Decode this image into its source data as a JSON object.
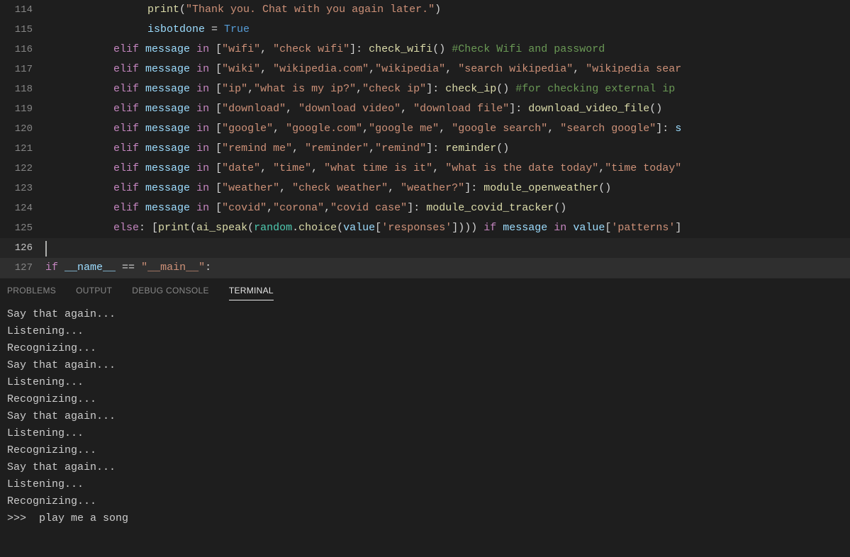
{
  "lines": {
    "start": 114,
    "rows": [
      {
        "n": 114,
        "indent": "i2",
        "tokens": [
          [
            "f",
            "print"
          ],
          [
            "p",
            "("
          ],
          [
            "s",
            "\"Thank you. Chat with you again later.\""
          ],
          [
            "p",
            ")"
          ]
        ]
      },
      {
        "n": 115,
        "indent": "i2",
        "tokens": [
          [
            "v",
            "isbotdone"
          ],
          [
            "o",
            " = "
          ],
          [
            "b",
            "True"
          ]
        ]
      },
      {
        "n": 116,
        "indent": "i1",
        "tokens": [
          [
            "k",
            "elif"
          ],
          [
            "o",
            " "
          ],
          [
            "v",
            "message"
          ],
          [
            "o",
            " "
          ],
          [
            "k",
            "in"
          ],
          [
            "o",
            " ["
          ],
          [
            "s",
            "\"wifi\""
          ],
          [
            "p",
            ", "
          ],
          [
            "s",
            "\"check wifi\""
          ],
          [
            "p",
            "]: "
          ],
          [
            "f",
            "check_wifi"
          ],
          [
            "p",
            "() "
          ],
          [
            "c",
            "#Check Wifi and password"
          ]
        ]
      },
      {
        "n": 117,
        "indent": "i1",
        "tokens": [
          [
            "k",
            "elif"
          ],
          [
            "o",
            " "
          ],
          [
            "v",
            "message"
          ],
          [
            "o",
            " "
          ],
          [
            "k",
            "in"
          ],
          [
            "o",
            " ["
          ],
          [
            "s",
            "\"wiki\""
          ],
          [
            "p",
            ", "
          ],
          [
            "s",
            "\"wikipedia.com\""
          ],
          [
            "p",
            ","
          ],
          [
            "s",
            "\"wikipedia\""
          ],
          [
            "p",
            ", "
          ],
          [
            "s",
            "\"search wikipedia\""
          ],
          [
            "p",
            ", "
          ],
          [
            "s",
            "\"wikipedia sear"
          ]
        ]
      },
      {
        "n": 118,
        "indent": "i1",
        "tokens": [
          [
            "k",
            "elif"
          ],
          [
            "o",
            " "
          ],
          [
            "v",
            "message"
          ],
          [
            "o",
            " "
          ],
          [
            "k",
            "in"
          ],
          [
            "o",
            " ["
          ],
          [
            "s",
            "\"ip\""
          ],
          [
            "p",
            ","
          ],
          [
            "s",
            "\"what is my ip?\""
          ],
          [
            "p",
            ","
          ],
          [
            "s",
            "\"check ip\""
          ],
          [
            "p",
            "]: "
          ],
          [
            "f",
            "check_ip"
          ],
          [
            "p",
            "() "
          ],
          [
            "c",
            "#for checking external ip "
          ]
        ]
      },
      {
        "n": 119,
        "indent": "i1",
        "tokens": [
          [
            "k",
            "elif"
          ],
          [
            "o",
            " "
          ],
          [
            "v",
            "message"
          ],
          [
            "o",
            " "
          ],
          [
            "k",
            "in"
          ],
          [
            "o",
            " ["
          ],
          [
            "s",
            "\"download\""
          ],
          [
            "p",
            ", "
          ],
          [
            "s",
            "\"download video\""
          ],
          [
            "p",
            ", "
          ],
          [
            "s",
            "\"download file\""
          ],
          [
            "p",
            "]: "
          ],
          [
            "f",
            "download_video_file"
          ],
          [
            "p",
            "()"
          ]
        ]
      },
      {
        "n": 120,
        "indent": "i1",
        "tokens": [
          [
            "k",
            "elif"
          ],
          [
            "o",
            " "
          ],
          [
            "v",
            "message"
          ],
          [
            "o",
            " "
          ],
          [
            "k",
            "in"
          ],
          [
            "o",
            " ["
          ],
          [
            "s",
            "\"google\""
          ],
          [
            "p",
            ", "
          ],
          [
            "s",
            "\"google.com\""
          ],
          [
            "p",
            ","
          ],
          [
            "s",
            "\"google me\""
          ],
          [
            "p",
            ", "
          ],
          [
            "s",
            "\"google search\""
          ],
          [
            "p",
            ", "
          ],
          [
            "s",
            "\"search google\""
          ],
          [
            "p",
            "]: "
          ],
          [
            "v",
            "s"
          ]
        ]
      },
      {
        "n": 121,
        "indent": "i1",
        "tokens": [
          [
            "k",
            "elif"
          ],
          [
            "o",
            " "
          ],
          [
            "v",
            "message"
          ],
          [
            "o",
            " "
          ],
          [
            "k",
            "in"
          ],
          [
            "o",
            " ["
          ],
          [
            "s",
            "\"remind me\""
          ],
          [
            "p",
            ", "
          ],
          [
            "s",
            "\"reminder\""
          ],
          [
            "p",
            ","
          ],
          [
            "s",
            "\"remind\""
          ],
          [
            "p",
            "]: "
          ],
          [
            "f",
            "reminder"
          ],
          [
            "p",
            "()"
          ]
        ]
      },
      {
        "n": 122,
        "indent": "i1",
        "tokens": [
          [
            "k",
            "elif"
          ],
          [
            "o",
            " "
          ],
          [
            "v",
            "message"
          ],
          [
            "o",
            " "
          ],
          [
            "k",
            "in"
          ],
          [
            "o",
            " ["
          ],
          [
            "s",
            "\"date\""
          ],
          [
            "p",
            ", "
          ],
          [
            "s",
            "\"time\""
          ],
          [
            "p",
            ", "
          ],
          [
            "s",
            "\"what time is it\""
          ],
          [
            "p",
            ", "
          ],
          [
            "s",
            "\"what is the date today\""
          ],
          [
            "p",
            ","
          ],
          [
            "s",
            "\"time today\""
          ]
        ]
      },
      {
        "n": 123,
        "indent": "i1",
        "tokens": [
          [
            "k",
            "elif"
          ],
          [
            "o",
            " "
          ],
          [
            "v",
            "message"
          ],
          [
            "o",
            " "
          ],
          [
            "k",
            "in"
          ],
          [
            "o",
            " ["
          ],
          [
            "s",
            "\"weather\""
          ],
          [
            "p",
            ", "
          ],
          [
            "s",
            "\"check weather\""
          ],
          [
            "p",
            ", "
          ],
          [
            "s",
            "\"weather?\""
          ],
          [
            "p",
            "]: "
          ],
          [
            "f",
            "module_openweather"
          ],
          [
            "p",
            "()"
          ]
        ]
      },
      {
        "n": 124,
        "indent": "i1",
        "tokens": [
          [
            "k",
            "elif"
          ],
          [
            "o",
            " "
          ],
          [
            "v",
            "message"
          ],
          [
            "o",
            " "
          ],
          [
            "k",
            "in"
          ],
          [
            "o",
            " ["
          ],
          [
            "s",
            "\"covid\""
          ],
          [
            "p",
            ","
          ],
          [
            "s",
            "\"corona\""
          ],
          [
            "p",
            ","
          ],
          [
            "s",
            "\"covid case\""
          ],
          [
            "p",
            "]: "
          ],
          [
            "f",
            "module_covid_tracker"
          ],
          [
            "p",
            "()"
          ]
        ]
      },
      {
        "n": 125,
        "indent": "i1",
        "tokens": [
          [
            "k",
            "else"
          ],
          [
            "p",
            ": ["
          ],
          [
            "f",
            "print"
          ],
          [
            "p",
            "("
          ],
          [
            "f",
            "ai_speak"
          ],
          [
            "p",
            "("
          ],
          [
            "mod",
            "random"
          ],
          [
            "p",
            "."
          ],
          [
            "f",
            "choice"
          ],
          [
            "p",
            "("
          ],
          [
            "v",
            "value"
          ],
          [
            "p",
            "["
          ],
          [
            "s",
            "'responses'"
          ],
          [
            "p",
            "]))) "
          ],
          [
            "k",
            "if"
          ],
          [
            "o",
            " "
          ],
          [
            "v",
            "message"
          ],
          [
            "o",
            " "
          ],
          [
            "k",
            "in"
          ],
          [
            "o",
            " "
          ],
          [
            "v",
            "value"
          ],
          [
            "p",
            "["
          ],
          [
            "s",
            "'patterns'"
          ],
          [
            "p",
            "]"
          ]
        ]
      },
      {
        "n": 126,
        "indent": "i0",
        "cursor": true,
        "tokens": []
      },
      {
        "n": 127,
        "indent": "i0",
        "hl": true,
        "tokens": [
          [
            "k",
            "if"
          ],
          [
            "o",
            " "
          ],
          [
            "v",
            "__name__"
          ],
          [
            "o",
            " == "
          ],
          [
            "s",
            "\"__main__\""
          ],
          [
            "p",
            ":"
          ]
        ]
      }
    ]
  },
  "tabs": {
    "items": [
      {
        "label": "PROBLEMS",
        "active": false
      },
      {
        "label": "OUTPUT",
        "active": false
      },
      {
        "label": "DEBUG CONSOLE",
        "active": false
      },
      {
        "label": "TERMINAL",
        "active": true
      }
    ]
  },
  "terminal": {
    "lines": [
      "Say that again...",
      "Listening...",
      "Recognizing...",
      "Say that again...",
      "Listening...",
      "Recognizing...",
      "Say that again...",
      "Listening...",
      "Recognizing...",
      "Say that again...",
      "Listening...",
      "Recognizing...",
      ">>>  play me a song"
    ]
  }
}
